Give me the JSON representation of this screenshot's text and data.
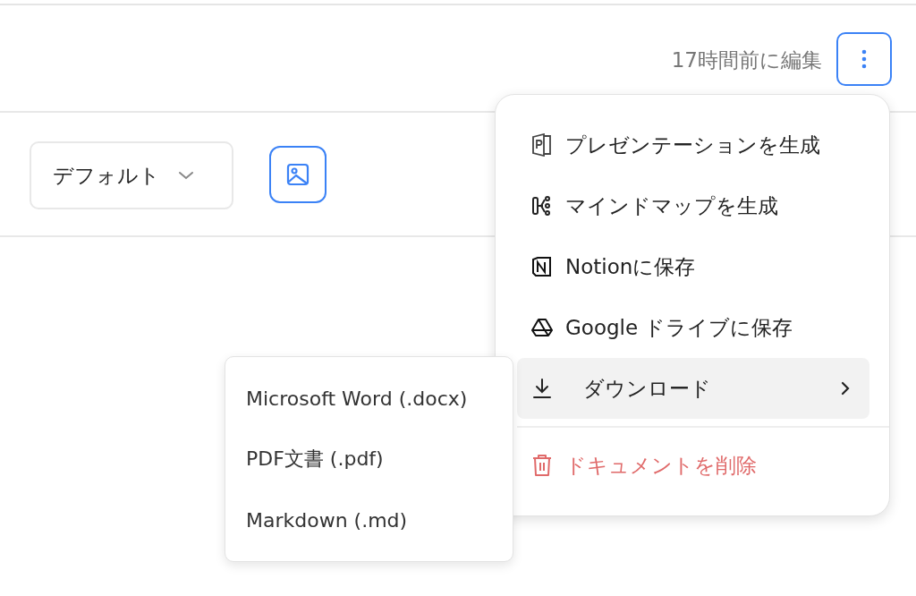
{
  "header": {
    "edited": "17時間前に編集"
  },
  "toolbar": {
    "style_select": {
      "value": "デフォルト"
    }
  },
  "menu": {
    "items": [
      {
        "kind": "presentation",
        "label": "プレゼンテーションを生成",
        "selected": false
      },
      {
        "kind": "mindmap",
        "label": "マインドマップを生成",
        "selected": false
      },
      {
        "kind": "notion",
        "label": "Notionに保存",
        "selected": false
      },
      {
        "kind": "drive",
        "label": "Google ドライブに保存",
        "selected": false
      },
      {
        "kind": "download",
        "label": "ダウンロード",
        "selected": true
      },
      {
        "kind": "delete",
        "label": "ドキュメントを削除",
        "selected": false
      }
    ]
  },
  "submenu": {
    "items": [
      {
        "label": "Microsoft Word (.docx)"
      },
      {
        "label": "PDF文書 (.pdf)"
      },
      {
        "label": "Markdown (.md)"
      }
    ]
  }
}
